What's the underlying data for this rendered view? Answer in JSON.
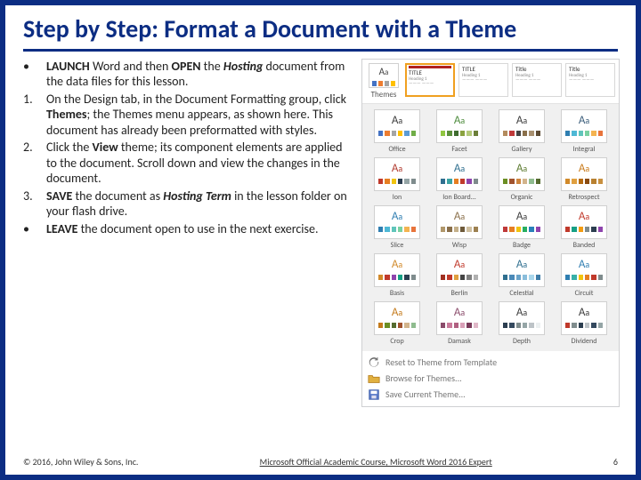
{
  "title": "Step by Step: Format a Document with a Theme",
  "steps": [
    {
      "marker": "•",
      "html": "<b>LAUNCH</b> Word and then <b>OPEN</b> the <i>Hosting</i> document from the data files for this lesson."
    },
    {
      "marker": "1.",
      "html": "On the Design tab, in the Document Formatting group, click <b>Themes</b>; the Themes menu appears, as shown here. This document has already been preformatted with styles."
    },
    {
      "marker": "2.",
      "html": "Click the <b>View</b> theme; its component elements are applied to the document. Scroll down and view the changes in the document."
    },
    {
      "marker": "3.",
      "html": "<b>SAVE</b> the document as <i>Hosting Term</i> in the lesson folder on your flash drive."
    },
    {
      "marker": "•",
      "html": "<b>LEAVE</b> the document open to use in the next exercise."
    }
  ],
  "gallery": {
    "themes_button": "Themes",
    "styleset_thumbs": [
      {
        "label": "TITLE",
        "selected": true
      },
      {
        "label": "TITLE",
        "selected": false
      },
      {
        "label": "Title",
        "selected": false
      },
      {
        "label": "Title",
        "selected": false
      }
    ],
    "themes": [
      {
        "name": "Office",
        "aa": "#3a3a3a",
        "c": [
          "#4472c4",
          "#ed7d31",
          "#a5a5a5",
          "#ffc000",
          "#5b9bd5",
          "#70ad47"
        ]
      },
      {
        "name": "Facet",
        "aa": "#4c8b3b",
        "c": [
          "#90c641",
          "#5b8f3b",
          "#3e6c2f",
          "#8aa23f",
          "#b4c97a",
          "#6c7f3a"
        ]
      },
      {
        "name": "Gallery",
        "aa": "#3a3a3a",
        "c": [
          "#b38b5d",
          "#bf3939",
          "#444444",
          "#8a6f4a",
          "#a89070",
          "#5c4a33"
        ]
      },
      {
        "name": "Integral",
        "aa": "#3a5c7a",
        "c": [
          "#2f7eb1",
          "#4eb8d5",
          "#60c5ba",
          "#7ad1a1",
          "#f4b350",
          "#e8743b"
        ]
      },
      {
        "name": "Ion",
        "aa": "#b03a2e",
        "c": [
          "#c0392b",
          "#e67e22",
          "#f1c40f",
          "#2c3e50",
          "#95a5a6",
          "#7f8c8d"
        ]
      },
      {
        "name": "Ion Board...",
        "aa": "#2f6f8f",
        "c": [
          "#2f6f8f",
          "#3aa3a3",
          "#e67e22",
          "#c0392b",
          "#8e44ad",
          "#7f8c8d"
        ]
      },
      {
        "name": "Organic",
        "aa": "#5b7a2e",
        "c": [
          "#6b8e23",
          "#a0522d",
          "#cd853f",
          "#d2b48c",
          "#8fbc8f",
          "#556b2f"
        ]
      },
      {
        "name": "Retrospect",
        "aa": "#c87a1a",
        "c": [
          "#d18a2a",
          "#e0a040",
          "#b56a10",
          "#8a4b10",
          "#b88030",
          "#c89040"
        ]
      },
      {
        "name": "Slice",
        "aa": "#2f7eb1",
        "c": [
          "#2f7eb1",
          "#4eb8d5",
          "#60c5ba",
          "#7ad1a1",
          "#f4b350",
          "#e8743b"
        ]
      },
      {
        "name": "Wisp",
        "aa": "#8a6f4a",
        "c": [
          "#b0976b",
          "#8a6f4a",
          "#c4b08a",
          "#6e5a3a",
          "#d0c0a0",
          "#9c8050"
        ]
      },
      {
        "name": "Badge",
        "aa": "#3a3a3a",
        "c": [
          "#bf3939",
          "#e67e22",
          "#f1c40f",
          "#27ae60",
          "#2980b9",
          "#8e44ad"
        ]
      },
      {
        "name": "Banded",
        "aa": "#c0392b",
        "c": [
          "#c0392b",
          "#16a085",
          "#f39c12",
          "#7f8c8d",
          "#2c3e50",
          "#8e44ad"
        ]
      },
      {
        "name": "Basis",
        "aa": "#d18a2a",
        "c": [
          "#d18a2a",
          "#c0392b",
          "#8e44ad",
          "#16a085",
          "#2c3e50",
          "#7f8c8d"
        ]
      },
      {
        "name": "Berlin",
        "aa": "#c0392b",
        "c": [
          "#a03020",
          "#c0392b",
          "#e0a040",
          "#444444",
          "#7f7f7f",
          "#b0b0b0"
        ]
      },
      {
        "name": "Celestial",
        "aa": "#2f6f8f",
        "c": [
          "#2f6f8f",
          "#4a89b8",
          "#6aa3c9",
          "#8abddb",
          "#aad7ec",
          "#3e7ca8"
        ]
      },
      {
        "name": "Circuit",
        "aa": "#2f7eb1",
        "c": [
          "#2f7eb1",
          "#38b0a8",
          "#f1c40f",
          "#e67e22",
          "#c0392b",
          "#7f8c8d"
        ]
      },
      {
        "name": "Crop",
        "aa": "#c47a1a",
        "c": [
          "#c47a1a",
          "#6b8e23",
          "#556b2f",
          "#a0522d",
          "#d2b48c",
          "#8fbc8f"
        ]
      },
      {
        "name": "Damask",
        "aa": "#8a4b6a",
        "c": [
          "#8a4b6a",
          "#c97a9a",
          "#b06080",
          "#d9a0b8",
          "#7a3a5a",
          "#e0b8c8"
        ]
      },
      {
        "name": "Depth",
        "aa": "#3a3a3a",
        "c": [
          "#2c3e50",
          "#34495e",
          "#7f8c8d",
          "#95a5a6",
          "#bdc3c7",
          "#ecf0f1"
        ]
      },
      {
        "name": "Dividend",
        "aa": "#3a3a3a",
        "c": [
          "#c0392b",
          "#7f8c8d",
          "#2c3e50",
          "#bdc3c7",
          "#34495e",
          "#95a5a6"
        ]
      }
    ],
    "reset_label": "Reset to Theme from Template",
    "browse_label": "Browse for Themes...",
    "save_label": "Save Current Theme..."
  },
  "footer": {
    "copyright": "© 2016, John Wiley & Sons, Inc.",
    "course": "Microsoft Official Academic Course, Microsoft Word 2016 Expert",
    "page": "6"
  }
}
